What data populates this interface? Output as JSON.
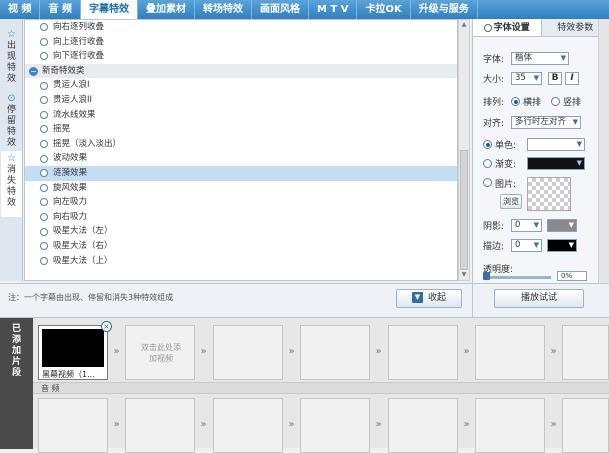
{
  "topbar": {
    "tabs": [
      {
        "label": "视 频",
        "active": false
      },
      {
        "label": "音 频",
        "active": false
      },
      {
        "label": "字幕特效",
        "active": true
      },
      {
        "label": "叠加素材",
        "active": false
      },
      {
        "label": "转场特效",
        "active": false
      },
      {
        "label": "画面风格",
        "active": false
      },
      {
        "label": "M T V",
        "active": false
      },
      {
        "label": "卡拉OK",
        "active": false
      },
      {
        "label": "升级与服务",
        "active": false
      }
    ]
  },
  "sidebar": {
    "tabs": [
      {
        "label": "出现特效",
        "icon": "star-icon"
      },
      {
        "label": "停留特效",
        "icon": "pin-icon"
      },
      {
        "label": "消失特效",
        "icon": "star-icon"
      }
    ]
  },
  "effects_list": {
    "rows": [
      {
        "label": "向右逐列收叠",
        "type": "item"
      },
      {
        "label": "向上逐行收叠",
        "type": "item"
      },
      {
        "label": "向下逐行收叠",
        "type": "item"
      },
      {
        "label": "新奇特效类",
        "type": "category"
      },
      {
        "label": "贵运人浪I",
        "type": "item"
      },
      {
        "label": "贵运人浪II",
        "type": "item"
      },
      {
        "label": "流水线效果",
        "type": "item"
      },
      {
        "label": "摇晃",
        "type": "item"
      },
      {
        "label": "摇晃（淡入淡出）",
        "type": "item"
      },
      {
        "label": "波动效果",
        "type": "item"
      },
      {
        "label": "涟漪效果",
        "type": "item",
        "selected": true
      },
      {
        "label": "旋风效果",
        "type": "item"
      },
      {
        "label": "向左吸力",
        "type": "item"
      },
      {
        "label": "向右吸力",
        "type": "item"
      },
      {
        "label": "吸星大法（左）",
        "type": "item"
      },
      {
        "label": "吸星大法（右）",
        "type": "item"
      },
      {
        "label": "吸星大法（上）",
        "type": "item"
      }
    ]
  },
  "panel": {
    "tab_font": "字体设置",
    "tab_effect": "特效参数",
    "font_label": "字体:",
    "font_value": "楷体",
    "size_label": "大小:",
    "size_value": "35",
    "bold": "B",
    "italic": "I",
    "layout_label": "排列:",
    "layout_horizontal": "横排",
    "layout_vertical": "竖排",
    "align_label": "对齐:",
    "align_value": "多行时左对齐",
    "single_color": "单色:",
    "gradient": "渐变:",
    "image": "图片:",
    "browse": "浏览",
    "shadow_label": "阴影:",
    "shadow_value": "0",
    "stroke_label": "描边:",
    "stroke_value": "0",
    "opacity_label": "透明度:",
    "opacity_value": "0%"
  },
  "bottom": {
    "note": "注：一个字幕由出现、停留和消失3种特效组成",
    "collapse_label": "收起",
    "preview_label": "播放试试"
  },
  "timeline": {
    "side_label": "已添加片段",
    "first_clip_label": "黑幕视频（1...",
    "empty_clip_hint": "双击此处添加视频",
    "audio_label": "音 频"
  },
  "colors": {
    "accent": "#2f7fc0",
    "selected_row": "#c6def5",
    "timeline_side": "#4a4a4a"
  }
}
